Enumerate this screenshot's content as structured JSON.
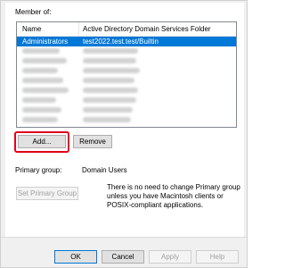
{
  "members_section": {
    "label": "Member of:",
    "columns": [
      "Name",
      "Active Directory Domain Services Folder"
    ],
    "selected_row": {
      "name": "Administrators",
      "folder": "test2022.test.test/Builtin"
    },
    "obscured_rows": 8
  },
  "buttons": {
    "add": "Add...",
    "remove": "Remove",
    "set_primary_group": "Set Primary Group",
    "ok": "OK",
    "cancel": "Cancel",
    "apply": "Apply",
    "help": "Help"
  },
  "primary_group": {
    "label": "Primary group:",
    "value": "Domain Users",
    "note": "There is no need to change Primary group unless you have Macintosh clients or POSIX-compliant applications."
  },
  "colors": {
    "selection": "#0078d7",
    "highlight_border": "#e0001b"
  }
}
